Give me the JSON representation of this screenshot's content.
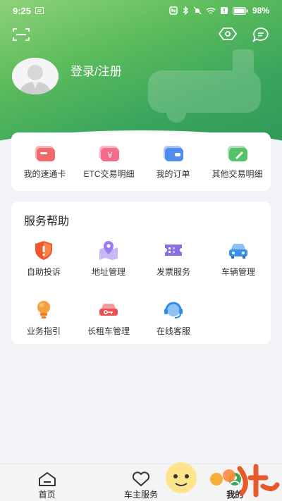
{
  "status_bar": {
    "time": "9:25",
    "battery": "98%"
  },
  "profile": {
    "login_label": "登录/注册"
  },
  "quick_actions": [
    {
      "label": "我的速通卡",
      "color": "#f06a6a"
    },
    {
      "label": "ETC交易明细",
      "color": "#f76b8a"
    },
    {
      "label": "我的订单",
      "color": "#4f8ef0"
    },
    {
      "label": "其他交易明细",
      "color": "#55c36a"
    }
  ],
  "services": {
    "title": "服务帮助",
    "items": [
      {
        "label": "自助投诉",
        "icon": "complaint-shield-icon",
        "color": "#f2552c"
      },
      {
        "label": "地址管理",
        "icon": "address-map-icon",
        "color": "#9b7cf0"
      },
      {
        "label": "发票服务",
        "icon": "invoice-ticket-icon",
        "color": "#8a6ee6"
      },
      {
        "label": "车辆管理",
        "icon": "car-icon",
        "color": "#3a8ef0"
      },
      {
        "label": "业务指引",
        "icon": "lightbulb-icon",
        "color": "#f5a03a"
      },
      {
        "label": "长租车管理",
        "icon": "rental-car-key-icon",
        "color": "#ef4f4f"
      },
      {
        "label": "在线客服",
        "icon": "headset-icon",
        "color": "#2e8ef0"
      }
    ]
  },
  "bottom_nav": [
    {
      "label": "首页",
      "icon": "home-icon"
    },
    {
      "label": "车主服务",
      "icon": "heart-icon"
    },
    {
      "label": "我的",
      "icon": "profile-icon",
      "active": true
    }
  ],
  "colors": {
    "brand_green": "#3aa55d"
  }
}
